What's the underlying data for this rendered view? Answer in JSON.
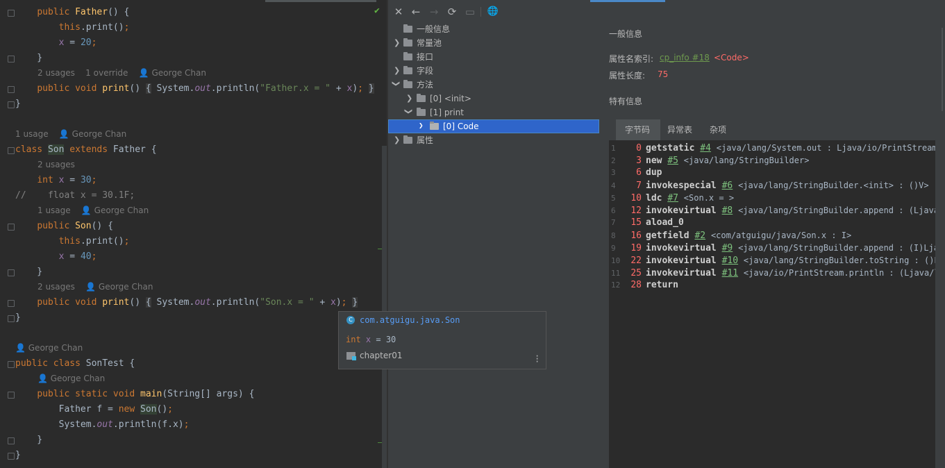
{
  "editor": {
    "lines": [
      {
        "segments": [
          {
            "t": "    "
          },
          {
            "t": "public ",
            "c": "kw"
          },
          {
            "t": "Father",
            "c": "fn"
          },
          {
            "t": "() {"
          }
        ]
      },
      {
        "segments": [
          {
            "t": "        "
          },
          {
            "t": "this",
            "c": "kw"
          },
          {
            "t": ".print()"
          },
          {
            "t": ";",
            "c": "kw"
          }
        ]
      },
      {
        "segments": [
          {
            "t": "        "
          },
          {
            "t": "x",
            "c": "fld"
          },
          {
            "t": " = "
          },
          {
            "t": "20",
            "c": "num"
          },
          {
            "t": ";",
            "c": "kw"
          }
        ]
      },
      {
        "segments": [
          {
            "t": "    }"
          }
        ]
      },
      {
        "inlay": "2 usages    1 override    👤 George Chan",
        "indent": 54
      },
      {
        "segments": [
          {
            "t": "    "
          },
          {
            "t": "public void ",
            "c": "kw"
          },
          {
            "t": "print",
            "c": "fn"
          },
          {
            "t": "() "
          },
          {
            "t": "{",
            "c": "gold"
          },
          {
            "t": " System."
          },
          {
            "t": "out",
            "c": "fld it"
          },
          {
            "t": ".println("
          },
          {
            "t": "\"Father.x = \"",
            "c": "str"
          },
          {
            "t": " + "
          },
          {
            "t": "x",
            "c": "fld"
          },
          {
            "t": ")"
          },
          {
            "t": ";",
            "c": "kw"
          },
          {
            "t": " "
          },
          {
            "t": "}",
            "c": "gold"
          }
        ]
      },
      {
        "segments": [
          {
            "t": "}"
          }
        ]
      },
      {
        "segments": [
          {
            "t": ""
          }
        ]
      },
      {
        "inlay": "1 usage    👤 George Chan",
        "indent": 22
      },
      {
        "segments": [
          {
            "t": "class ",
            "c": "kw"
          },
          {
            "t": "Son",
            "c": "hl"
          },
          {
            "t": " "
          },
          {
            "t": "extends ",
            "c": "kw"
          },
          {
            "t": "Father {"
          }
        ]
      },
      {
        "inlay": "2 usages",
        "indent": 54
      },
      {
        "segments": [
          {
            "t": "    "
          },
          {
            "t": "int ",
            "c": "kw"
          },
          {
            "t": "x",
            "c": "fld"
          },
          {
            "t": " = "
          },
          {
            "t": "30",
            "c": "num"
          },
          {
            "t": ";",
            "c": "kw"
          }
        ]
      },
      {
        "segments": [
          {
            "t": "//    float x = 30.1F;",
            "c": "cm"
          }
        ]
      },
      {
        "inlay": "1 usage    👤 George Chan",
        "indent": 54
      },
      {
        "segments": [
          {
            "t": "    "
          },
          {
            "t": "public ",
            "c": "kw"
          },
          {
            "t": "Son",
            "c": "fn"
          },
          {
            "t": "() {"
          }
        ]
      },
      {
        "segments": [
          {
            "t": "        "
          },
          {
            "t": "this",
            "c": "kw"
          },
          {
            "t": ".print()"
          },
          {
            "t": ";",
            "c": "kw"
          }
        ]
      },
      {
        "segments": [
          {
            "t": "        "
          },
          {
            "t": "x",
            "c": "fld"
          },
          {
            "t": " = "
          },
          {
            "t": "40",
            "c": "num"
          },
          {
            "t": ";",
            "c": "kw"
          }
        ]
      },
      {
        "segments": [
          {
            "t": "    }"
          }
        ]
      },
      {
        "inlay": "2 usages    👤 George Chan",
        "indent": 54
      },
      {
        "segments": [
          {
            "t": "    "
          },
          {
            "t": "public void ",
            "c": "kw"
          },
          {
            "t": "print",
            "c": "fn"
          },
          {
            "t": "() "
          },
          {
            "t": "{",
            "c": "gold"
          },
          {
            "t": " System."
          },
          {
            "t": "out",
            "c": "fld it"
          },
          {
            "t": ".println("
          },
          {
            "t": "\"Son.x = \"",
            "c": "str"
          },
          {
            "t": " + "
          },
          {
            "t": "x",
            "c": "fld"
          },
          {
            "t": ")"
          },
          {
            "t": ";",
            "c": "kw"
          },
          {
            "t": " "
          },
          {
            "t": "}",
            "c": "gold"
          }
        ]
      },
      {
        "segments": [
          {
            "t": "}"
          }
        ]
      },
      {
        "segments": [
          {
            "t": ""
          }
        ]
      },
      {
        "inlay": "👤 George Chan",
        "indent": 22
      },
      {
        "segments": [
          {
            "t": "public class ",
            "c": "kw"
          },
          {
            "t": "SonTest {"
          }
        ]
      },
      {
        "inlay": "👤 George Chan",
        "indent": 54
      },
      {
        "segments": [
          {
            "t": "    "
          },
          {
            "t": "public static void ",
            "c": "kw"
          },
          {
            "t": "main",
            "c": "fn"
          },
          {
            "t": "(String[] args) {"
          }
        ]
      },
      {
        "segments": [
          {
            "t": "        Father f = "
          },
          {
            "t": "new ",
            "c": "kw"
          },
          {
            "t": "Son",
            "c": "hl"
          },
          {
            "t": "()"
          },
          {
            "t": ";",
            "c": "kw"
          }
        ]
      },
      {
        "segments": [
          {
            "t": "        System."
          },
          {
            "t": "out",
            "c": "fld it"
          },
          {
            "t": ".println(f.x)"
          },
          {
            "t": ";",
            "c": "kw"
          }
        ]
      },
      {
        "segments": [
          {
            "t": "    }"
          }
        ]
      },
      {
        "segments": [
          {
            "t": "}"
          }
        ]
      }
    ]
  },
  "popup": {
    "class_name": "com.atguigu.java.Son",
    "field_kw": "int ",
    "field_name": "x",
    "field_rest": " = 30",
    "module": "chapter01"
  },
  "toolbar": {
    "icons": [
      "close-icon",
      "back-icon",
      "forward-icon",
      "refresh-icon",
      "save-icon",
      "web-icon"
    ],
    "glyphs": [
      "✕",
      "←",
      "→",
      "⟳",
      "▭",
      "🌐"
    ]
  },
  "tree": {
    "items": [
      "一般信息",
      "常量池",
      "接口",
      "字段",
      "方法",
      "[0] <init>",
      "[1] print",
      "[0] Code",
      "属性"
    ]
  },
  "general": {
    "section_title": "一般信息",
    "name_index_label": "属性名索引:",
    "name_index_link": "cp_info #18",
    "name_index_value": "<Code>",
    "length_label": "属性长度:",
    "length_value": "75",
    "specific_title": "特有信息"
  },
  "tabs": [
    "字节码",
    "异常表",
    "杂项"
  ],
  "bytecode": [
    {
      "n": "1",
      "off": "0",
      "op": "getstatic",
      "ref": "#4",
      "arg": "<java/lang/System.out : Ljava/io/PrintStream;>"
    },
    {
      "n": "2",
      "off": "3",
      "op": "new",
      "ref": "#5",
      "arg": "<java/lang/StringBuilder>"
    },
    {
      "n": "3",
      "off": "6",
      "op": "dup",
      "ref": "",
      "arg": ""
    },
    {
      "n": "4",
      "off": "7",
      "op": "invokespecial",
      "ref": "#6",
      "arg": "<java/lang/StringBuilder.<init> : ()V>"
    },
    {
      "n": "5",
      "off": "10",
      "op": "ldc",
      "ref": "#7",
      "arg": "<Son.x = >"
    },
    {
      "n": "6",
      "off": "12",
      "op": "invokevirtual",
      "ref": "#8",
      "arg": "<java/lang/StringBuilder.append : (Ljava/lang/String;)>"
    },
    {
      "n": "7",
      "off": "15",
      "op": "aload_0",
      "ref": "",
      "arg": ""
    },
    {
      "n": "8",
      "off": "16",
      "op": "getfield",
      "ref": "#2",
      "arg": "<com/atguigu/java/Son.x : I>"
    },
    {
      "n": "9",
      "off": "19",
      "op": "invokevirtual",
      "ref": "#9",
      "arg": "<java/lang/StringBuilder.append : (I)Ljava/lang/>"
    },
    {
      "n": "10",
      "off": "22",
      "op": "invokevirtual",
      "ref": "#10",
      "arg": "<java/lang/StringBuilder.toString : ()Ljava/lang/>"
    },
    {
      "n": "11",
      "off": "25",
      "op": "invokevirtual",
      "ref": "#11",
      "arg": "<java/io/PrintStream.println : (Ljava/lang/String;)>"
    },
    {
      "n": "12",
      "off": "28",
      "op": "return",
      "ref": "",
      "arg": ""
    }
  ],
  "colors": {
    "selection": "#2f65ca",
    "offset": "#ff6b68",
    "ref": "#7ec27e"
  }
}
